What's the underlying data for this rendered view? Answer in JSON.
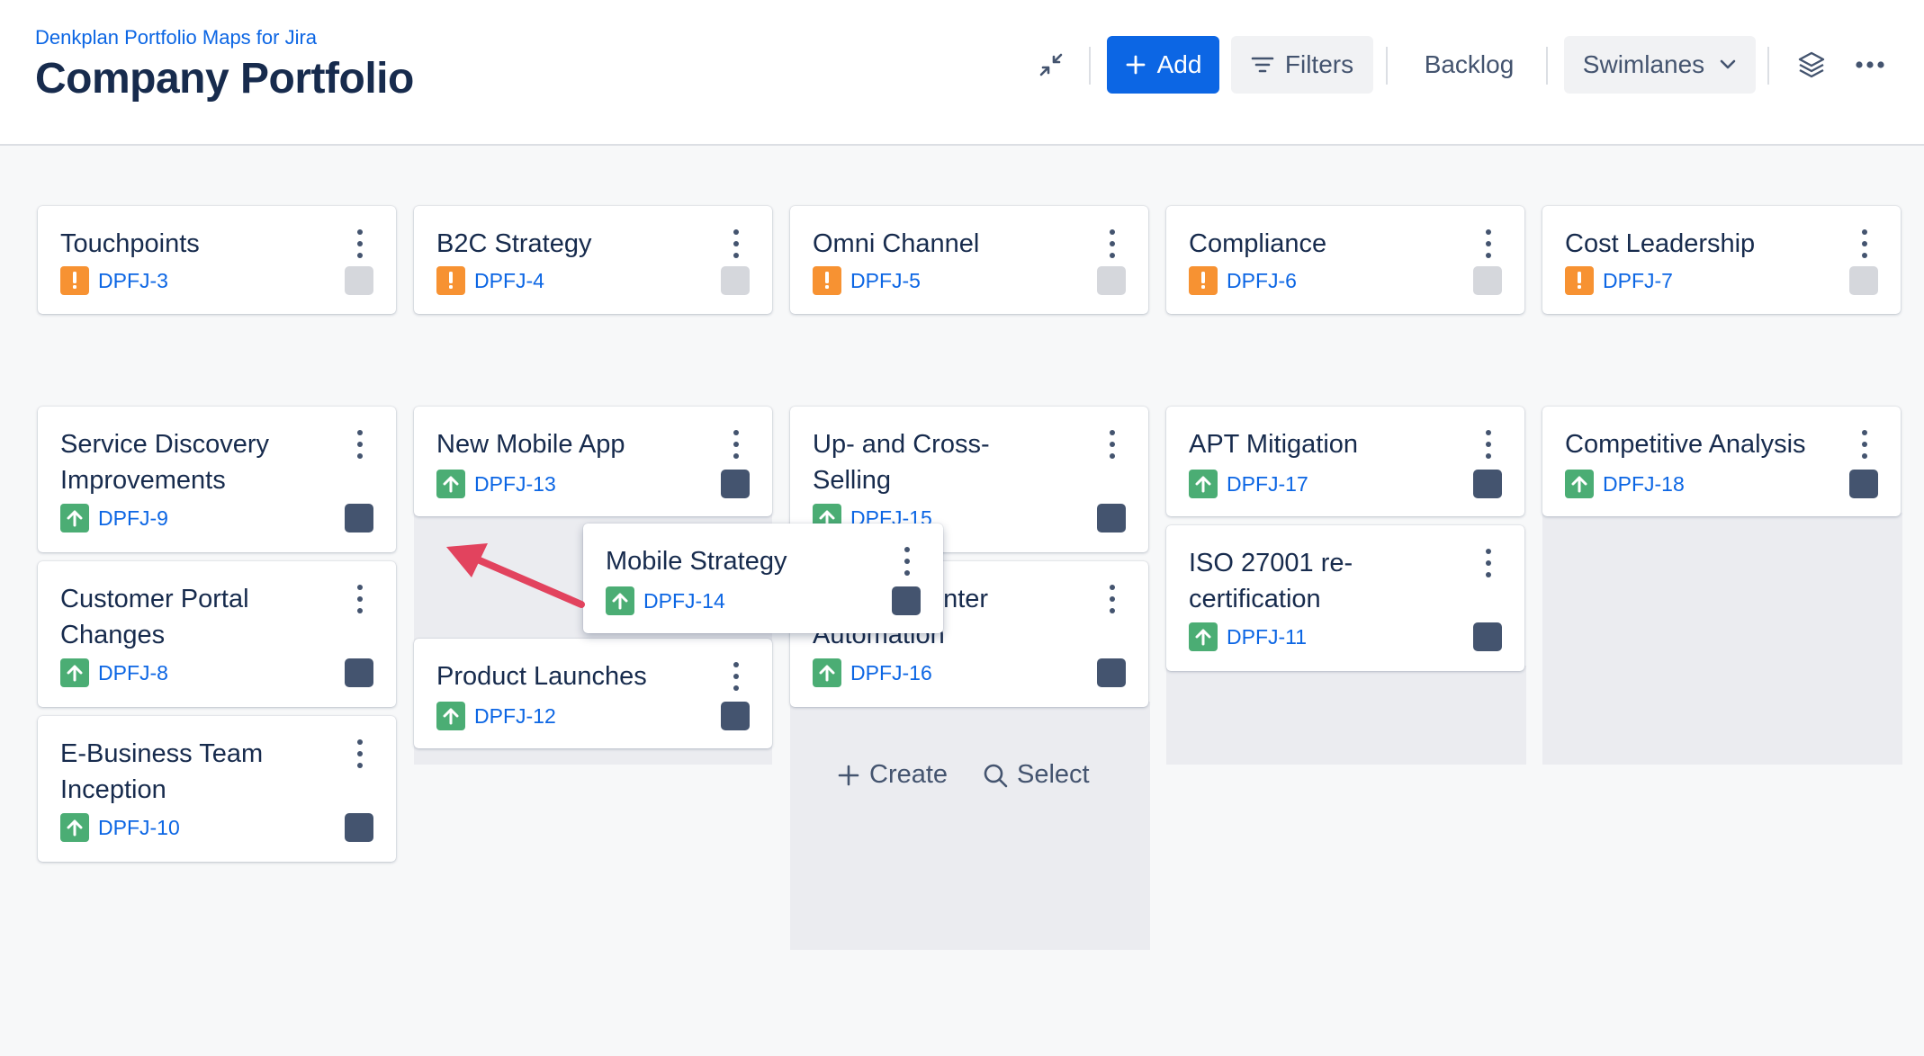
{
  "header": {
    "app_name": "Denkplan Portfolio Maps for Jira",
    "title": "Company Portfolio",
    "add_label": "Add",
    "filters_label": "Filters",
    "backlog_label": "Backlog",
    "swimlanes_label": "Swimlanes"
  },
  "colors": {
    "accent": "#0c66e4",
    "risk": "#f79232",
    "improvement": "#4bad74",
    "status_done": "#44546f",
    "status_todo": "#d5d7dc",
    "arrow": "#e2435e"
  },
  "top_row": [
    {
      "title": "Touchpoints",
      "key": "DPFJ-3"
    },
    {
      "title": "B2C Strategy",
      "key": "DPFJ-4"
    },
    {
      "title": "Omni Channel",
      "key": "DPFJ-5"
    },
    {
      "title": "Compliance",
      "key": "DPFJ-6"
    },
    {
      "title": "Cost Leadership",
      "key": "DPFJ-7"
    }
  ],
  "col1": [
    {
      "title": "Service Discovery Improvements",
      "key": "DPFJ-9"
    },
    {
      "title": "Customer Portal Changes",
      "key": "DPFJ-8"
    },
    {
      "title": "E-Business Team Inception",
      "key": "DPFJ-10"
    }
  ],
  "col2": [
    {
      "title": "New Mobile App",
      "key": "DPFJ-13"
    },
    {
      "title": "Product Launches",
      "key": "DPFJ-12"
    }
  ],
  "col3": [
    {
      "title": "Up- and Cross-Selling",
      "key": "DPFJ-15"
    },
    {
      "title": "Contact Center Automation",
      "key": "DPFJ-16"
    }
  ],
  "col4": [
    {
      "title": "APT Mitigation",
      "key": "DPFJ-17"
    },
    {
      "title": "ISO 27001 re-certification",
      "key": "DPFJ-11"
    }
  ],
  "col5": [
    {
      "title": "Competitive Analysis",
      "key": "DPFJ-18"
    }
  ],
  "dragging": {
    "title": "Mobile Strategy",
    "key": "DPFJ-14"
  },
  "column_actions": {
    "create_label": "Create",
    "select_label": "Select"
  }
}
